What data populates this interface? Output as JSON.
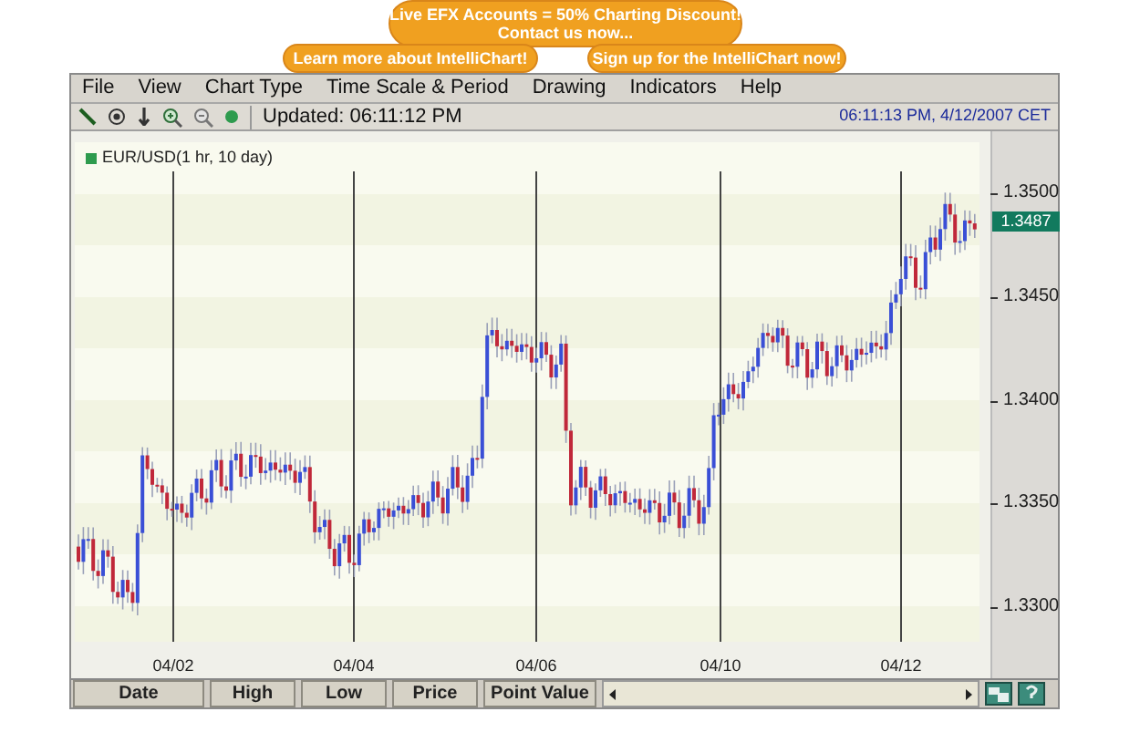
{
  "banners": [
    {
      "lines": [
        "Live EFX Accounts = 50% Charting Discount!",
        "Contact us now..."
      ]
    },
    {
      "lines": [
        "Learn more about IntelliChart!"
      ]
    },
    {
      "lines": [
        "Sign up for the IntelliChart now!"
      ]
    }
  ],
  "menu": [
    "File",
    "View",
    "Chart Type",
    "Time Scale & Period",
    "Drawing",
    "Indicators",
    "Help"
  ],
  "toolbar": {
    "updated": "Updated: 06:11:12 PM",
    "clock": "06:11:13 PM, 4/12/2007 CET"
  },
  "chart": {
    "legend": "EUR/USD(1 hr, 10 day)",
    "y_ticks": [
      "1.3500",
      "1.3450",
      "1.3400",
      "1.3350",
      "1.3300"
    ],
    "price_tag": "1.3487",
    "x_labels": [
      "04/02",
      "04/04",
      "04/06",
      "04/10",
      "04/12"
    ]
  },
  "columns": [
    "Date",
    "High",
    "Low",
    "Price",
    "Point Value"
  ]
}
